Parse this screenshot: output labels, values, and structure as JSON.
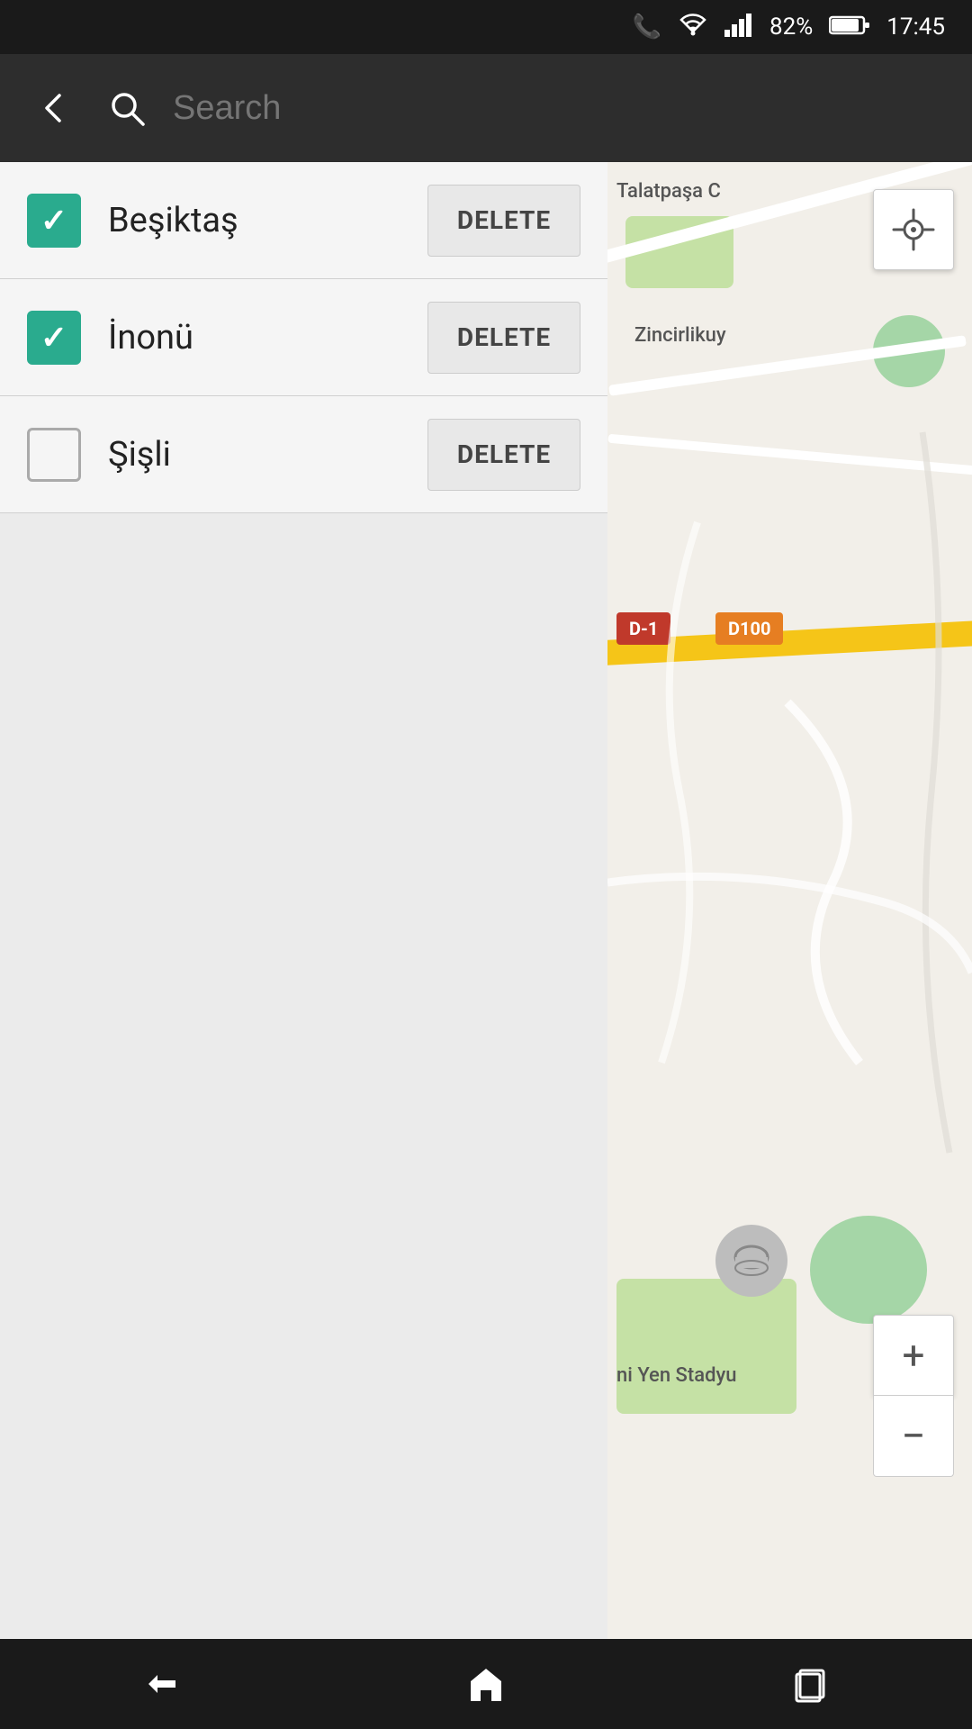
{
  "statusBar": {
    "battery": "82%",
    "time": "17:45"
  },
  "appBar": {
    "searchPlaceholder": "Search",
    "backLabel": "←",
    "searchIconLabel": "🔍"
  },
  "listItems": [
    {
      "id": "besiktas",
      "label": "Beşiktaş",
      "checked": true,
      "deleteLabel": "DELETE"
    },
    {
      "id": "inonü",
      "label": "İnonü",
      "checked": true,
      "deleteLabel": "DELETE"
    },
    {
      "id": "sisli",
      "label": "Şişli",
      "checked": false,
      "deleteLabel": "DELETE"
    }
  ],
  "map": {
    "locateBtnLabel": "⊕",
    "zoomInLabel": "+",
    "zoomOutLabel": "−",
    "labels": {
      "talatpasa": "Talatpaşa C",
      "zincirlikuyu": "Zincirlikuy",
      "stadium": "ni Yen Stadyu"
    },
    "badges": {
      "highway": "D-1",
      "d100": "D100"
    }
  },
  "navBar": {
    "backLabel": "↩",
    "homeLabel": "⌂",
    "recentLabel": "❒"
  }
}
